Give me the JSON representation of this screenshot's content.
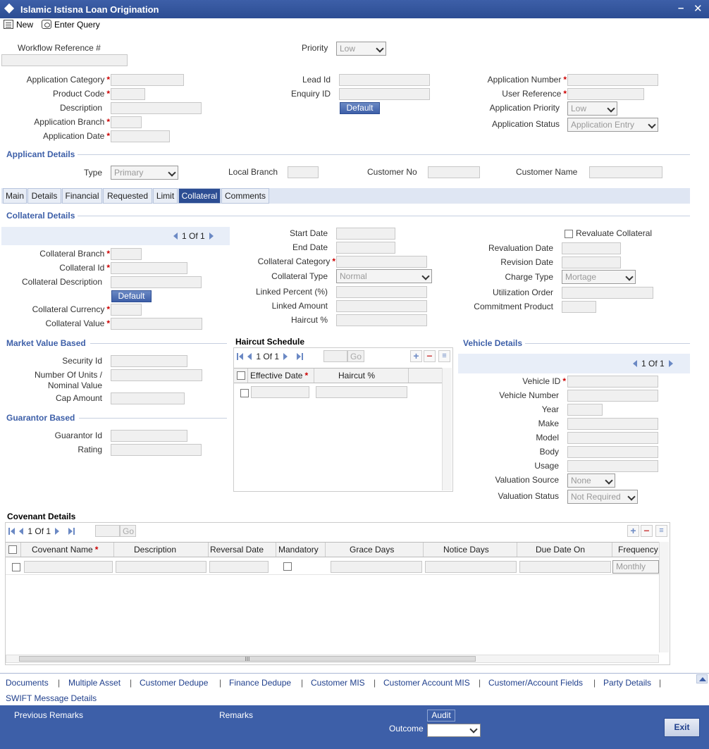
{
  "window": {
    "title": "Islamic Istisna Loan Origination",
    "minimize": "–",
    "close": "✕"
  },
  "toolbar": {
    "new_label": "New",
    "enter_query_label": "Enter Query"
  },
  "header": {
    "workflow_ref_label": "Workflow Reference #",
    "priority_label": "Priority",
    "priority_value": "Low",
    "app_category_label": "Application Category",
    "product_code_label": "Product Code",
    "description_label": "Description",
    "app_branch_label": "Application Branch",
    "app_date_label": "Application Date",
    "lead_id_label": "Lead Id",
    "enquiry_id_label": "Enquiry ID",
    "default_label": "Default",
    "app_number_label": "Application Number",
    "user_ref_label": "User Reference",
    "app_priority_label": "Application Priority",
    "app_priority_value": "Low",
    "app_status_label": "Application Status",
    "app_status_value": "Application Entry",
    "required_mark": "*"
  },
  "applicant": {
    "section_title": "Applicant Details",
    "type_label": "Type",
    "type_value": "Primary",
    "local_branch_label": "Local Branch",
    "customer_no_label": "Customer No",
    "customer_name_label": "Customer Name"
  },
  "tabs": [
    "Main",
    "Details",
    "Financial",
    "Requested",
    "Limit",
    "Collateral",
    "Comments"
  ],
  "collateral": {
    "section_title": "Collateral Details",
    "pager_current": "1",
    "pager_of": "Of",
    "pager_total": "1",
    "branch_label": "Collateral Branch",
    "id_label": "Collateral Id",
    "desc_label": "Collateral Description",
    "default_label": "Default",
    "currency_label": "Collateral Currency",
    "value_label": "Collateral Value",
    "start_date_label": "Start Date",
    "end_date_label": "End Date",
    "category_label": "Collateral Category",
    "type_label": "Collateral Type",
    "type_value": "Normal",
    "linked_percent_label": "Linked Percent (%)",
    "linked_amount_label": "Linked Amount",
    "haircut_label": "Haircut %",
    "revaluate_label": "Revaluate Collateral",
    "revaluation_date_label": "Revaluation Date",
    "revision_date_label": "Revision Date",
    "charge_type_label": "Charge Type",
    "charge_type_value": "Mortage",
    "utilization_order_label": "Utilization Order",
    "commitment_product_label": "Commitment Product"
  },
  "market": {
    "section_title": "Market Value Based",
    "security_id_label": "Security Id",
    "units_label_1": "Number Of Units /",
    "units_label_2": "Nominal Value",
    "cap_amount_label": "Cap Amount"
  },
  "guarantor": {
    "section_title": "Guarantor Based",
    "guarantor_id_label": "Guarantor Id",
    "rating_label": "Rating"
  },
  "haircut": {
    "section_title": "Haircut Schedule",
    "pager_current": "1",
    "pager_of": "Of",
    "pager_total": "1",
    "go_label": "Go",
    "col_effective_date": "Effective Date",
    "col_haircut": "Haircut %"
  },
  "vehicle": {
    "section_title": "Vehicle Details",
    "pager_current": "1",
    "pager_of": "Of",
    "pager_total": "1",
    "vehicle_id_label": "Vehicle ID",
    "vehicle_number_label": "Vehicle Number",
    "year_label": "Year",
    "make_label": "Make",
    "model_label": "Model",
    "body_label": "Body",
    "usage_label": "Usage",
    "valuation_source_label": "Valuation Source",
    "valuation_source_value": "None",
    "valuation_status_label": "Valuation Status",
    "valuation_status_value": "Not Required"
  },
  "covenant": {
    "section_title": "Covenant Details",
    "pager_current": "1",
    "pager_of": "Of",
    "pager_total": "1",
    "go_label": "Go",
    "columns": [
      "Covenant Name",
      "Description",
      "Reversal Date",
      "Mandatory",
      "Grace Days",
      "Notice Days",
      "Due Date On",
      "Frequency"
    ],
    "frequency_value": "Monthly",
    "hscroll_grip": "III"
  },
  "links": [
    "Documents",
    "Multiple Asset",
    "Customer Dedupe",
    "Finance Dedupe",
    "Customer MIS",
    "Customer Account MIS",
    "Customer/Account Fields",
    "Party Details",
    "SWIFT Message Details"
  ],
  "link_separator": "|",
  "footer": {
    "previous_remarks_label": "Previous Remarks",
    "remarks_label": "Remarks",
    "audit_label": "Audit",
    "outcome_label": "Outcome",
    "exit_label": "Exit"
  }
}
